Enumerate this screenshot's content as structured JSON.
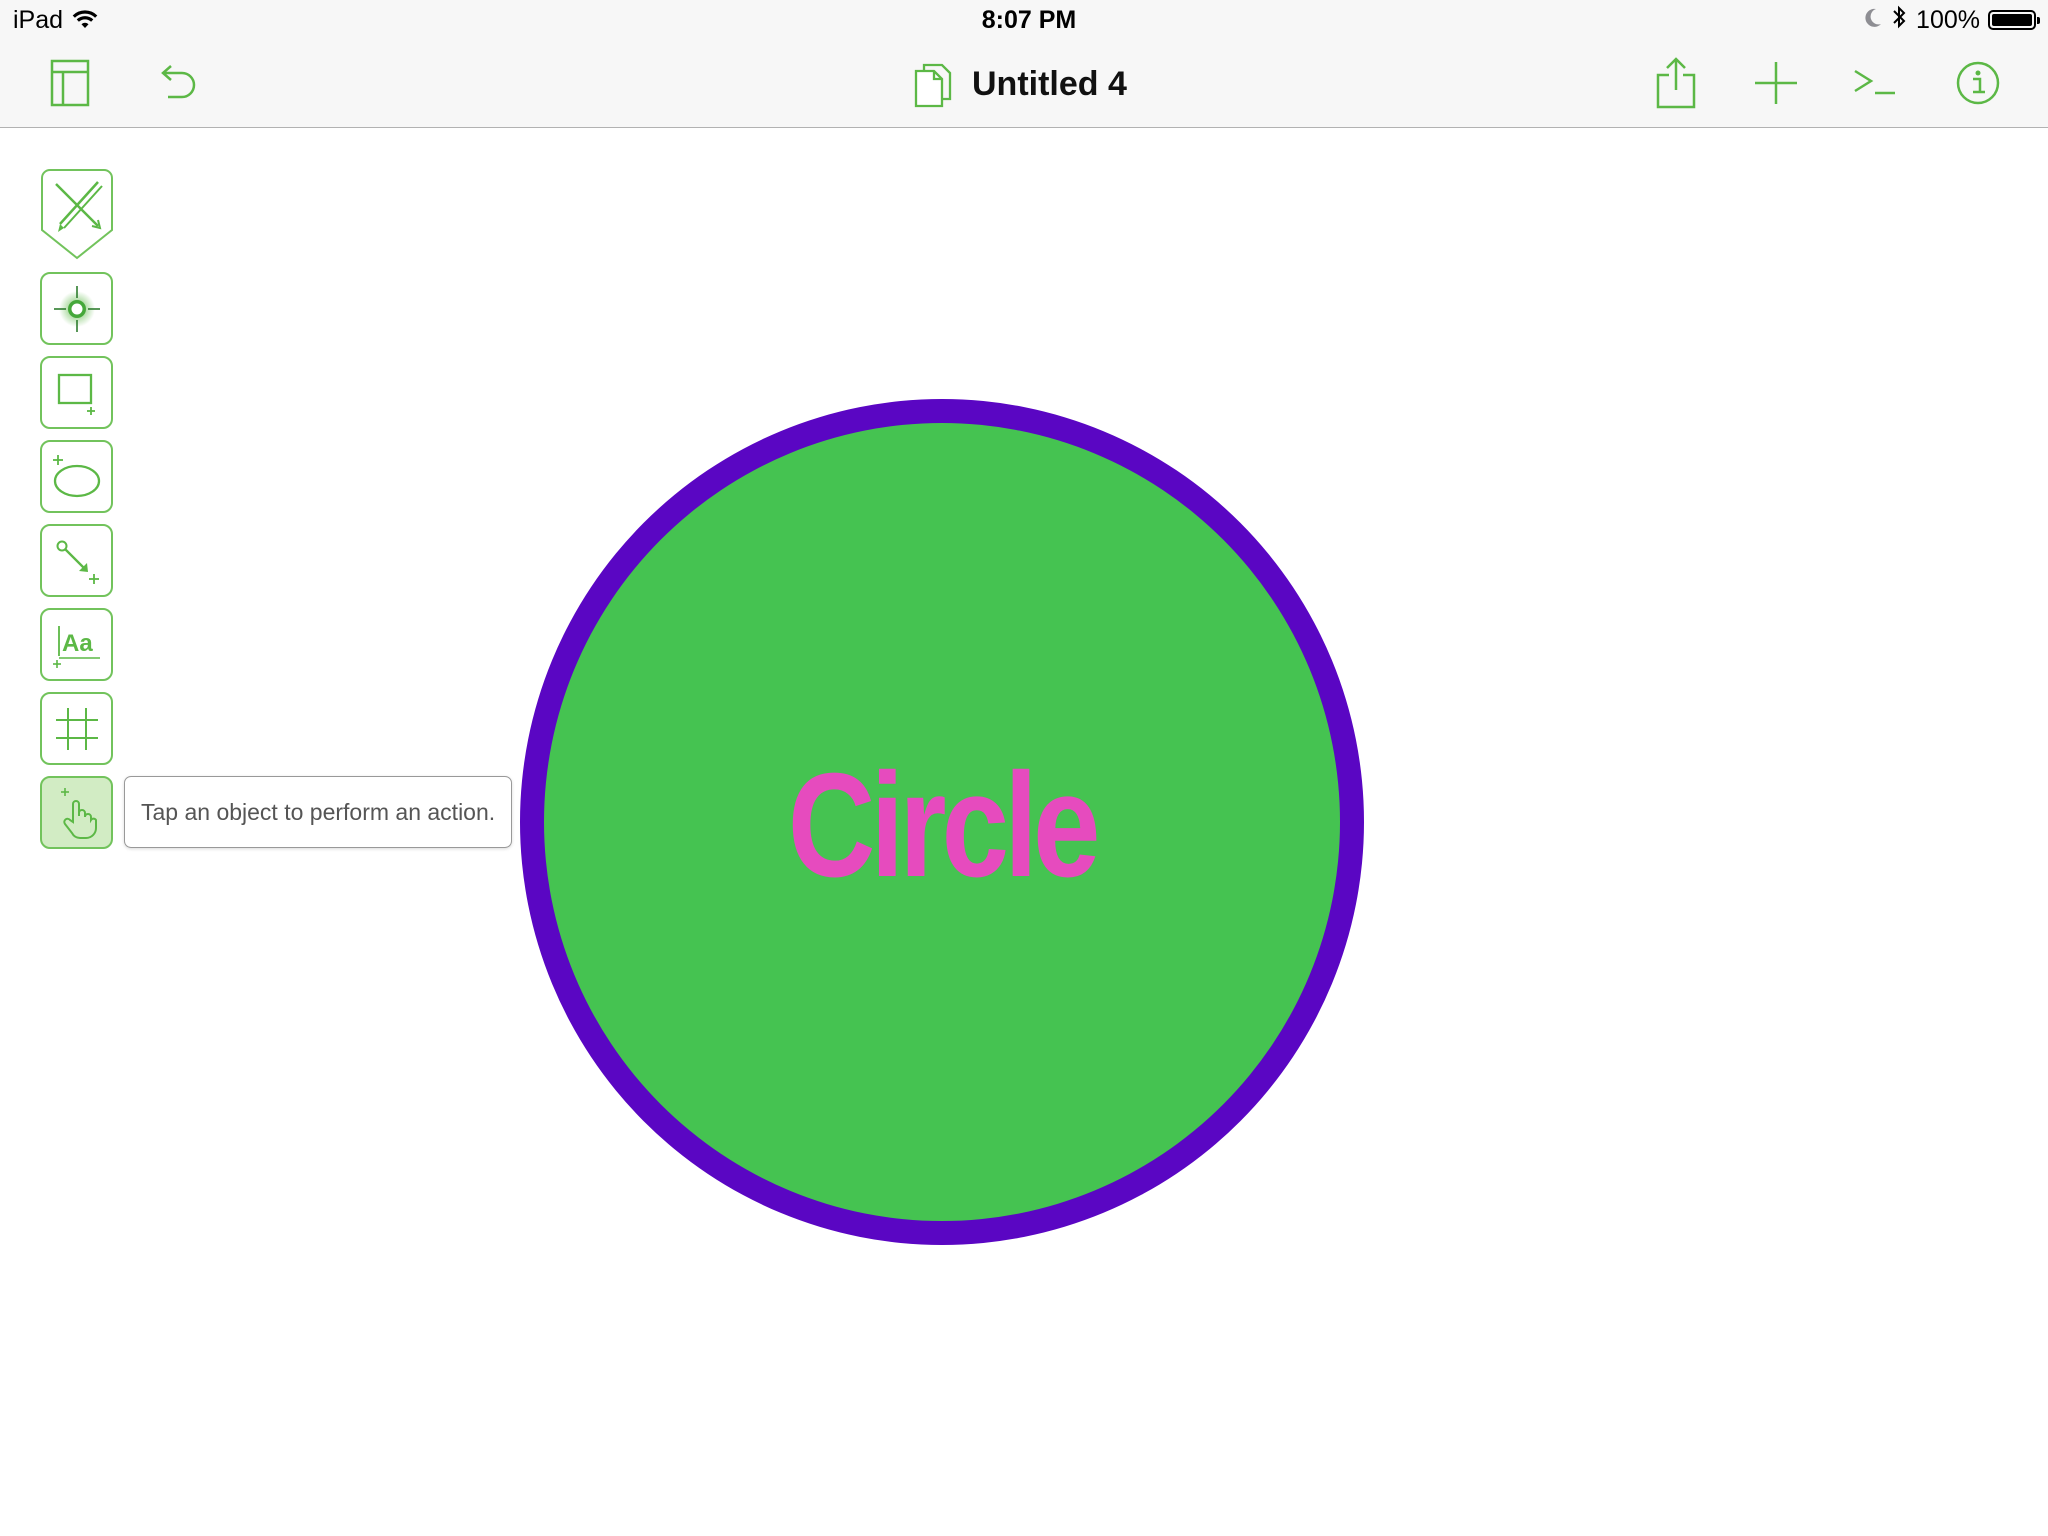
{
  "status_bar": {
    "device": "iPad",
    "time": "8:07 PM",
    "battery_percent": "100%"
  },
  "toolbar": {
    "document_title": "Untitled 4",
    "buttons": {
      "sidebar": "sidebar-icon",
      "undo": "undo-icon",
      "share": "share-icon",
      "add": "plus-icon",
      "console": "console-icon",
      "inspector": "info-icon"
    }
  },
  "tools": [
    {
      "name": "style",
      "icon": "pencil-ruler-icon"
    },
    {
      "name": "selection",
      "icon": "target-icon"
    },
    {
      "name": "rectangle",
      "icon": "rectangle-icon"
    },
    {
      "name": "shape",
      "icon": "ellipse-icon"
    },
    {
      "name": "line",
      "icon": "line-icon"
    },
    {
      "name": "text",
      "icon": "text-aa-icon",
      "label": "Aa"
    },
    {
      "name": "diagram",
      "icon": "crop-grid-icon"
    },
    {
      "name": "action",
      "icon": "hand-pointer-icon",
      "active": true
    }
  ],
  "tooltip": {
    "text": "Tap an object to perform an action."
  },
  "canvas": {
    "shape_label": "Circle",
    "fill_color": "#45c351",
    "stroke_color": "#5a06c3",
    "text_color": "#e64bbe"
  },
  "colors": {
    "accent": "#5cb846",
    "toolbar_bg": "#f7f7f7"
  }
}
